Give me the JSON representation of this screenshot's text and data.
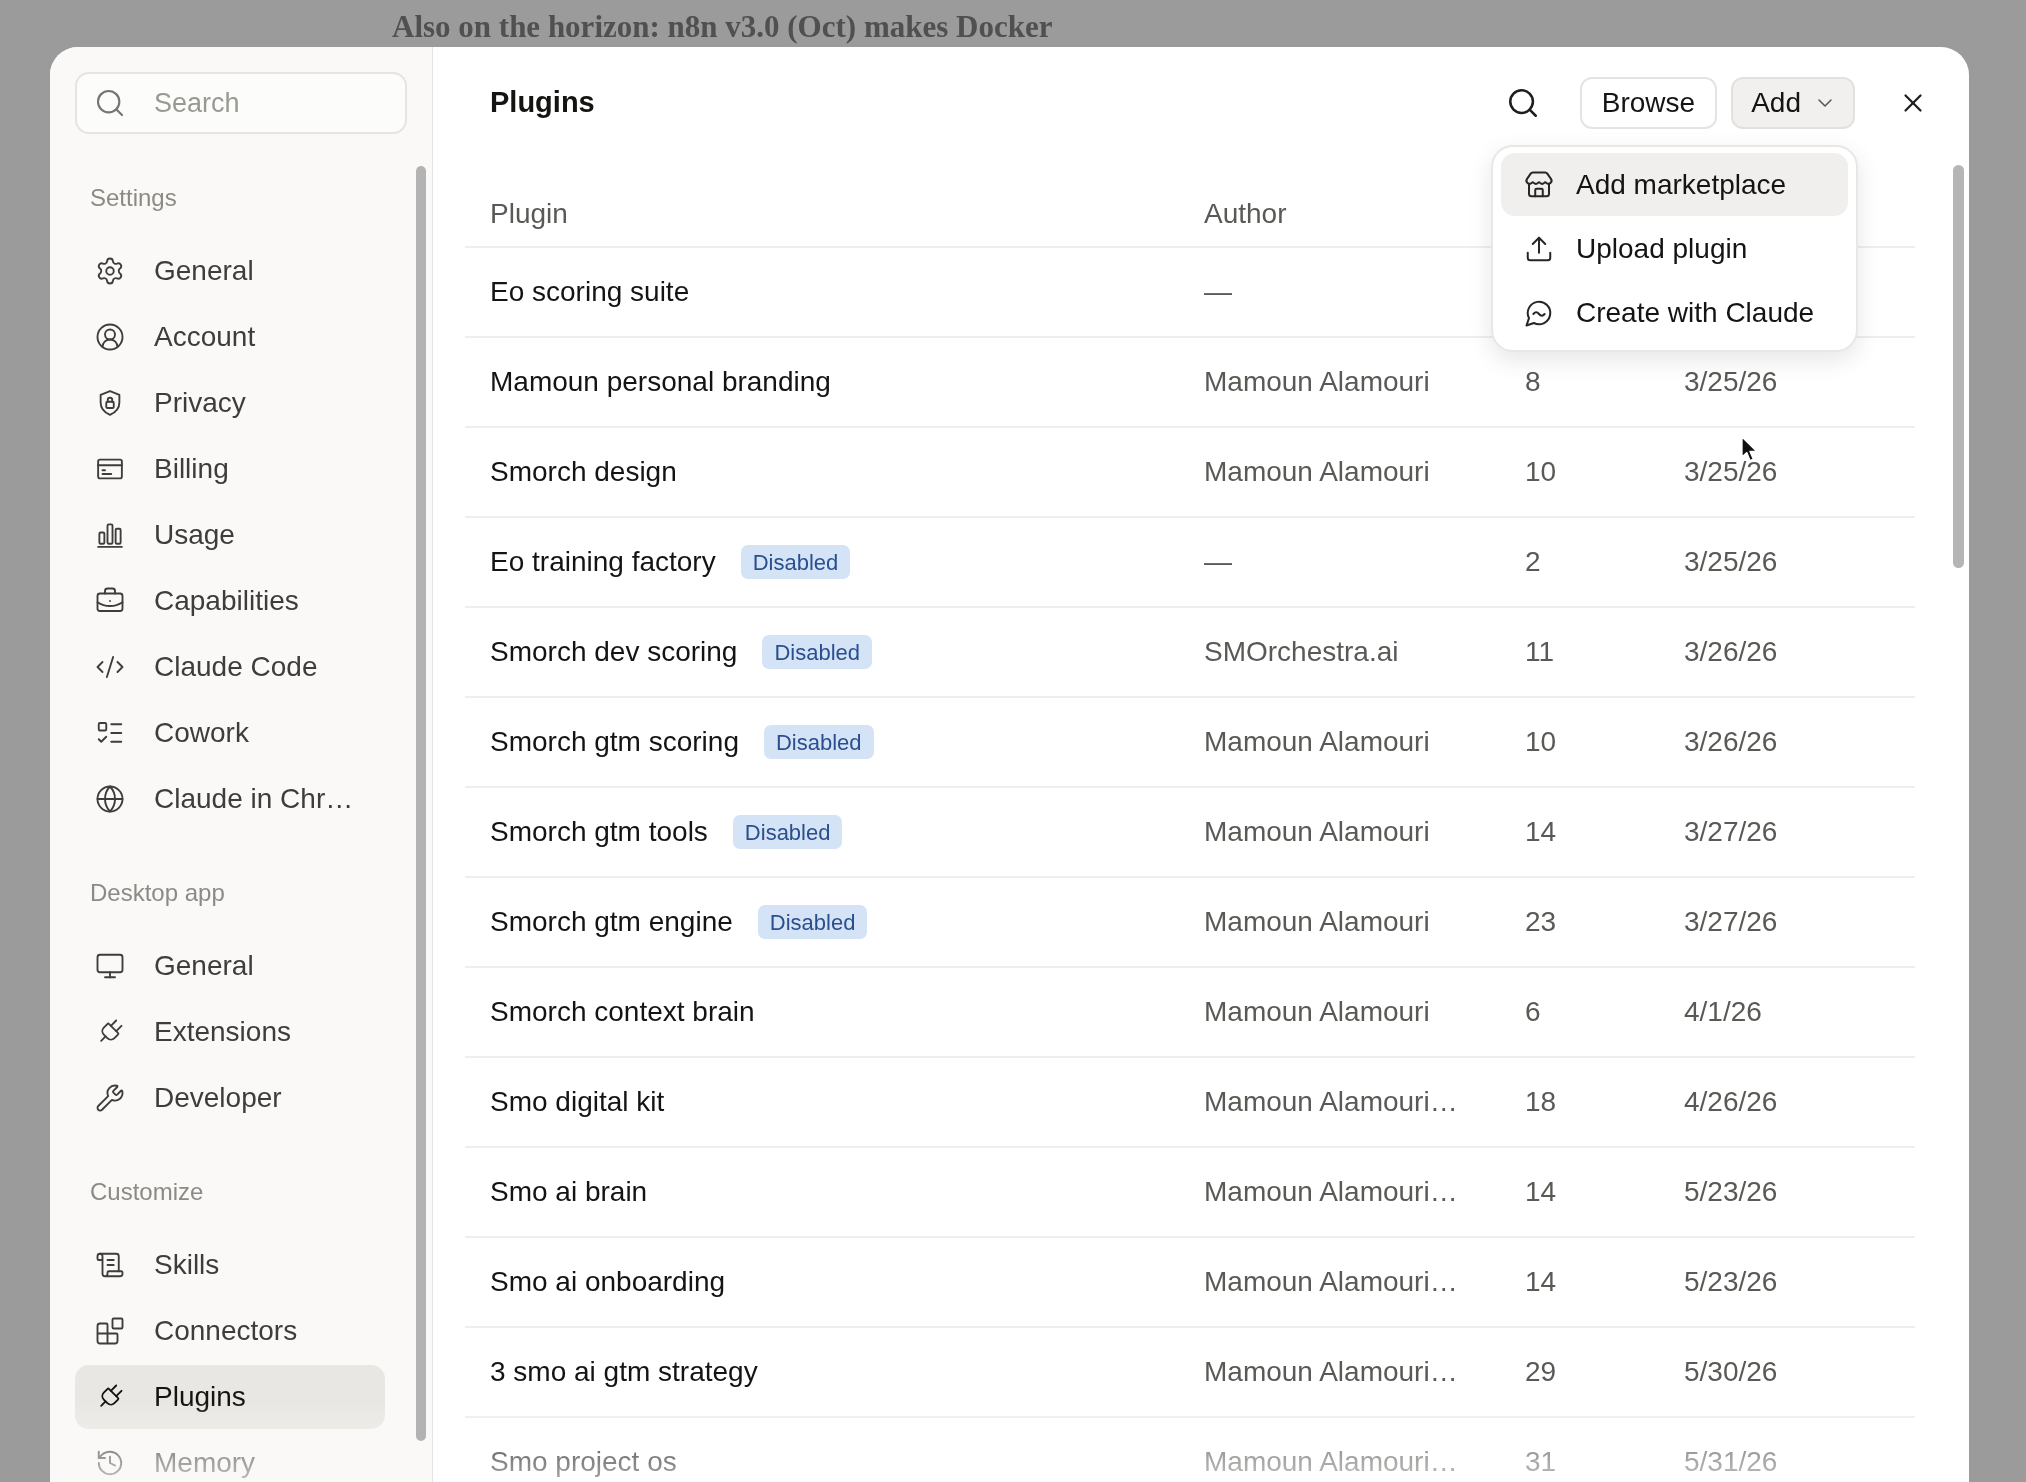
{
  "background": {
    "headline": "Also on the horizon: n8n v3.0 (Oct) makes Docker"
  },
  "sidebar": {
    "search": {
      "placeholder": "Search"
    },
    "sections": [
      {
        "title": "Settings",
        "items": [
          {
            "label": "General",
            "selected": false
          },
          {
            "label": "Account",
            "selected": false
          },
          {
            "label": "Privacy",
            "selected": false
          },
          {
            "label": "Billing",
            "selected": false
          },
          {
            "label": "Usage",
            "selected": false
          },
          {
            "label": "Capabilities",
            "selected": false
          },
          {
            "label": "Claude Code",
            "selected": false
          },
          {
            "label": "Cowork",
            "selected": false
          },
          {
            "label": "Claude in Chr…",
            "selected": false
          }
        ]
      },
      {
        "title": "Desktop app",
        "items": [
          {
            "label": "General",
            "selected": false
          },
          {
            "label": "Extensions",
            "selected": false
          },
          {
            "label": "Developer",
            "selected": false
          }
        ]
      },
      {
        "title": "Customize",
        "items": [
          {
            "label": "Skills",
            "selected": false
          },
          {
            "label": "Connectors",
            "selected": false
          },
          {
            "label": "Plugins",
            "selected": true
          },
          {
            "label": "Memory",
            "selected": false
          }
        ]
      }
    ]
  },
  "main": {
    "title": "Plugins",
    "browse_button": {
      "label": "Browse"
    },
    "add_button": {
      "label": "Add",
      "expanded": true
    },
    "add_menu": {
      "items": [
        {
          "label": "Add marketplace",
          "highlighted": true
        },
        {
          "label": "Upload plugin",
          "highlighted": false
        },
        {
          "label": "Create with Claude",
          "highlighted": false
        }
      ]
    },
    "table": {
      "columns": [
        "Plugin",
        "Author"
      ],
      "rows": [
        {
          "plugin": "Eo scoring suite",
          "author": "—"
        },
        {
          "plugin": "Mamoun personal branding",
          "author": "Mamoun Alamouri",
          "column_3": "8",
          "column_4": "3/25/26"
        },
        {
          "plugin": "Smorch design",
          "author": "Mamoun Alamouri",
          "column_3": "10",
          "column_4": "3/25/26"
        },
        {
          "plugin": "Eo training factory",
          "badge": "Disabled",
          "author": "—",
          "column_3": "2",
          "column_4": "3/25/26"
        },
        {
          "plugin": "Smorch dev scoring",
          "badge": "Disabled",
          "author": "SMOrchestra.ai",
          "column_3": "11",
          "column_4": "3/26/26"
        },
        {
          "plugin": "Smorch gtm scoring",
          "badge": "Disabled",
          "author": "Mamoun Alamouri",
          "column_3": "10",
          "column_4": "3/26/26"
        },
        {
          "plugin": "Smorch gtm tools",
          "badge": "Disabled",
          "author": "Mamoun Alamouri",
          "column_3": "14",
          "column_4": "3/27/26"
        },
        {
          "plugin": "Smorch gtm engine",
          "badge": "Disabled",
          "author": "Mamoun Alamouri",
          "column_3": "23",
          "column_4": "3/27/26"
        },
        {
          "plugin": "Smorch context brain",
          "author": "Mamoun Alamouri",
          "column_3": "6",
          "column_4": "4/1/26"
        },
        {
          "plugin": "Smo digital kit",
          "author": "Mamoun Alamouri…",
          "column_3": "18",
          "column_4": "4/26/26"
        },
        {
          "plugin": "Smo ai brain",
          "author": "Mamoun Alamouri…",
          "column_3": "14",
          "column_4": "5/23/26"
        },
        {
          "plugin": "Smo ai onboarding",
          "author": "Mamoun Alamouri…",
          "column_3": "14",
          "column_4": "5/23/26"
        },
        {
          "plugin": "3 smo ai gtm strategy",
          "author": "Mamoun Alamouri…",
          "column_3": "29",
          "column_4": "5/30/26"
        },
        {
          "plugin": "Smo project os",
          "author": "Mamoun Alamouri…",
          "column_3": "31",
          "column_4": "5/31/26"
        }
      ]
    }
  }
}
